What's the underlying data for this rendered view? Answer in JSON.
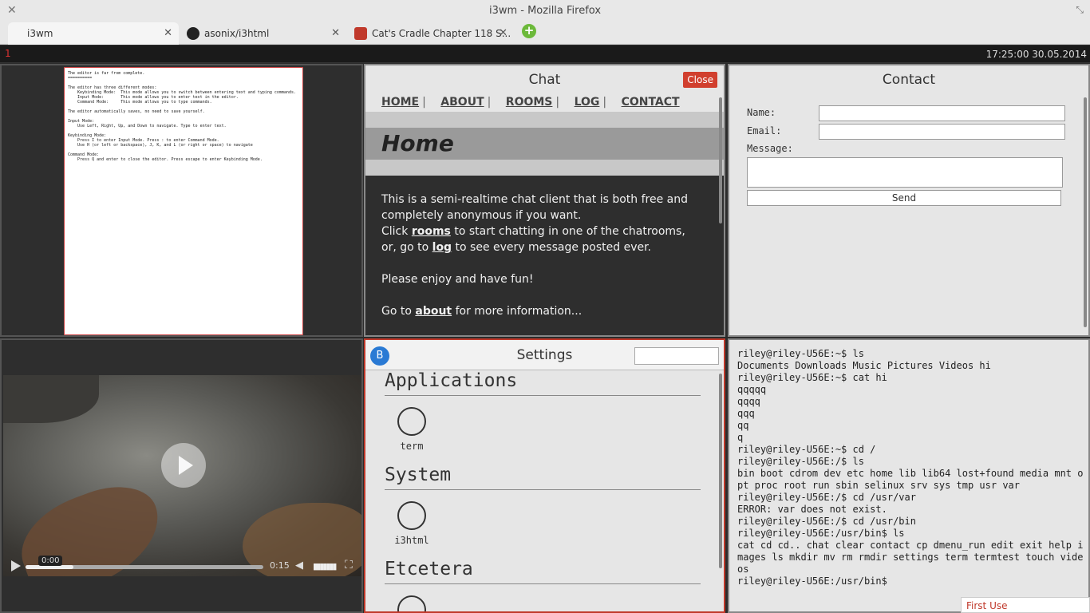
{
  "window": {
    "title": "i3wm - Mozilla Firefox"
  },
  "tabs": [
    {
      "label": "i3wm"
    },
    {
      "label": "asonix/i3html"
    },
    {
      "label": "Cat's Cradle Chapter 118 S..."
    }
  ],
  "i3bar": {
    "workspace": "1",
    "clock": "17:25:00 30.05.2014"
  },
  "editor": {
    "lines": "The editor is far from complete.\n==========\n\nThe editor has three different modes:\n    Keybinding Mode:  This mode allows you to switch between entering text and typing commands.\n    Input Mode:       This mode allows you to enter text in the editor.\n    Command Mode:     This mode allows you to type commands.\n\nThe editor automatically saves, no need to save yourself.\n\nInput Mode:\n    Use Left, Right, Up, and Down to navigate. Type to enter text.\n\nKeybinding Mode:\n    Press I to enter Input Mode. Press : to enter Command Mode.\n    Use H (or left or backspace), J, K, and L (or right or space) to navigate\n\nCommand Mode:\n    Press Q and enter to close the editor. Press escape to enter Keybinding Mode."
  },
  "chat": {
    "title": "Chat",
    "close_label": "Close",
    "nav": [
      "HOME",
      "ABOUT",
      "ROOMS",
      "LOG",
      "CONTACT"
    ],
    "hero": "Home",
    "p1a": "This is a semi-realtime chat client that is both free and completely anonymous if you want.",
    "p1b_pre": "Click ",
    "p1b_link": "rooms",
    "p1b_post": " to start chatting in one of the chatrooms,",
    "p1c_pre": "or, go to ",
    "p1c_link": "log",
    "p1c_post": " to see every message posted ever.",
    "p2": "Please enjoy and have fun!",
    "p3_pre": "Go to ",
    "p3_link": "about",
    "p3_post": " for more information..."
  },
  "contact": {
    "title": "Contact",
    "name_label": "Name:",
    "email_label": "Email:",
    "message_label": "Message:",
    "send_label": "Send"
  },
  "video": {
    "current": "0:00",
    "duration": "0:15",
    "progress": 0.2
  },
  "settings": {
    "badge": "B",
    "title": "Settings",
    "sections": [
      {
        "title": "Applications",
        "items": [
          "term"
        ]
      },
      {
        "title": "System",
        "items": [
          "i3html"
        ]
      },
      {
        "title": "Etcetera",
        "items": []
      }
    ]
  },
  "terminal": {
    "text": "riley@riley-U56E:~$ ls\nDocuments Downloads Music Pictures Videos hi\nriley@riley-U56E:~$ cat hi\nqqqqq\nqqqq\nqqq\nqq\nq\nriley@riley-U56E:~$ cd /\nriley@riley-U56E:/$ ls\nbin boot cdrom dev etc home lib lib64 lost+found media mnt opt proc root run sbin selinux srv sys tmp usr var\nriley@riley-U56E:/$ cd /usr/var\nERROR: var does not exist.\nriley@riley-U56E:/$ cd /usr/bin\nriley@riley-U56E:/usr/bin$ ls\ncat cd cd.. chat clear contact cp dmenu_run edit exit help images ls mkdir mv rm rmdir settings term termtest touch videos\nriley@riley-U56E:/usr/bin$"
  },
  "first_use": "First Use"
}
